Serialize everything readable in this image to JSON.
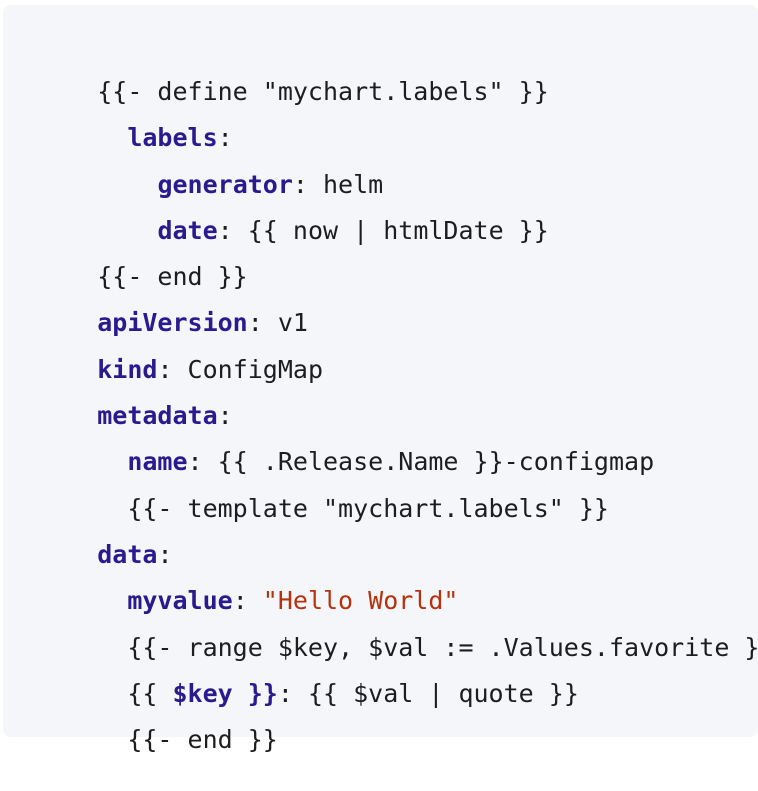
{
  "code_block": {
    "lines": [
      [
        {
          "t": "plain",
          "v": "{{- define \"mychart.labels\" }}"
        }
      ],
      [
        {
          "t": "plain",
          "v": "  "
        },
        {
          "t": "key",
          "v": "labels"
        },
        {
          "t": "plain",
          "v": ":"
        }
      ],
      [
        {
          "t": "plain",
          "v": "    "
        },
        {
          "t": "key",
          "v": "generator"
        },
        {
          "t": "plain",
          "v": ": helm"
        }
      ],
      [
        {
          "t": "plain",
          "v": "    "
        },
        {
          "t": "key",
          "v": "date"
        },
        {
          "t": "plain",
          "v": ": {{ now | htmlDate }}"
        }
      ],
      [
        {
          "t": "plain",
          "v": "{{- end }}"
        }
      ],
      [
        {
          "t": "key",
          "v": "apiVersion"
        },
        {
          "t": "plain",
          "v": ": v1"
        }
      ],
      [
        {
          "t": "key",
          "v": "kind"
        },
        {
          "t": "plain",
          "v": ": ConfigMap"
        }
      ],
      [
        {
          "t": "key",
          "v": "metadata"
        },
        {
          "t": "plain",
          "v": ":"
        }
      ],
      [
        {
          "t": "plain",
          "v": "  "
        },
        {
          "t": "key",
          "v": "name"
        },
        {
          "t": "plain",
          "v": ": {{ .Release.Name }}-configmap"
        }
      ],
      [
        {
          "t": "plain",
          "v": "  {{- template \"mychart.labels\" }}"
        }
      ],
      [
        {
          "t": "key",
          "v": "data"
        },
        {
          "t": "plain",
          "v": ":"
        }
      ],
      [
        {
          "t": "plain",
          "v": "  "
        },
        {
          "t": "key",
          "v": "myvalue"
        },
        {
          "t": "plain",
          "v": ": "
        },
        {
          "t": "str",
          "v": "\"Hello World\""
        }
      ],
      [
        {
          "t": "plain",
          "v": "  {{- range $key, $val := .Values.favorite }}"
        }
      ],
      [
        {
          "t": "plain",
          "v": "  {{ "
        },
        {
          "t": "key",
          "v": "$key }}"
        },
        {
          "t": "plain",
          "v": ": {{ $val | quote }}"
        }
      ],
      [
        {
          "t": "plain",
          "v": "  {{- end }}"
        }
      ]
    ]
  },
  "colors": {
    "background": "#f4f6f9",
    "key": "#2b1a8f",
    "string": "#b6320f",
    "text": "#1d1d1f"
  }
}
